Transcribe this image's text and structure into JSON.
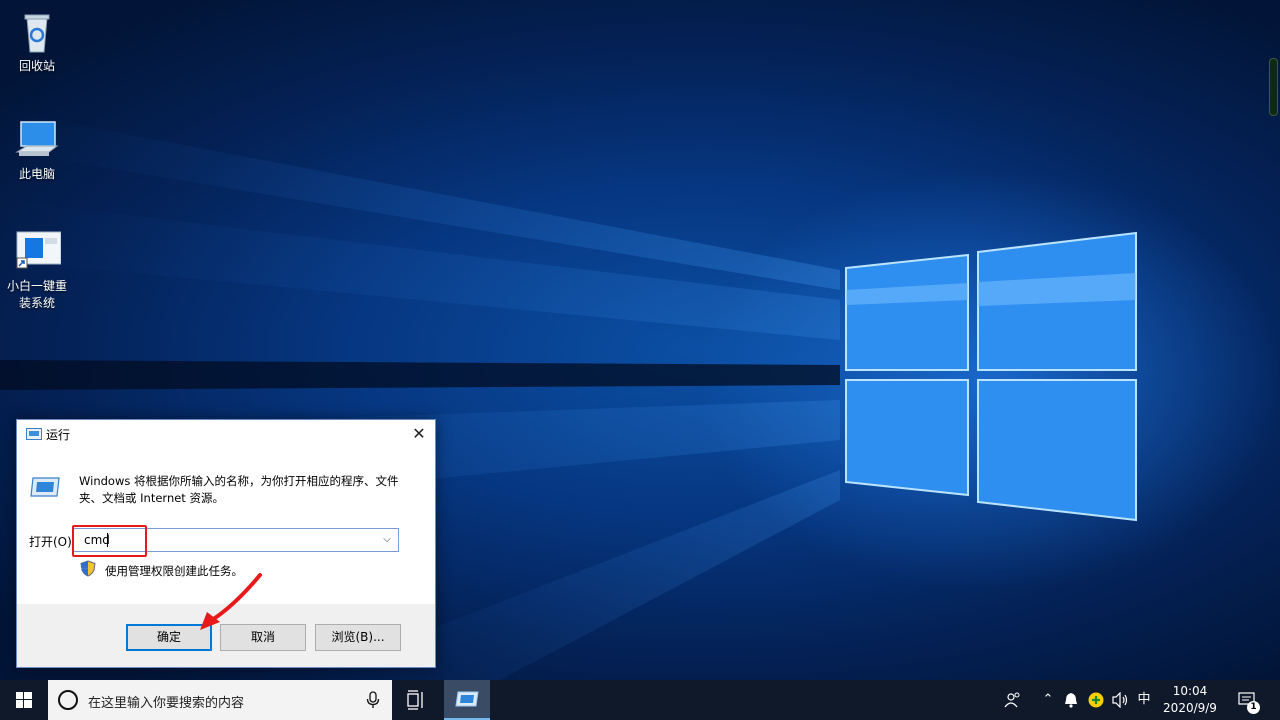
{
  "desktop": {
    "icons": [
      {
        "label": "回收站",
        "icon": "recycle-bin-icon"
      },
      {
        "label": "此电脑",
        "icon": "computer-icon"
      },
      {
        "label": "小白一键重装系统",
        "icon": "app-shortcut-icon"
      }
    ]
  },
  "run_dialog": {
    "title": "运行",
    "description": "Windows 将根据你所输入的名称，为你打开相应的程序、文件夹、文档或 Internet 资源。",
    "open_label": "打开(O):",
    "open_value": "cmd",
    "admin_text": "使用管理权限创建此任务。",
    "ok_label": "确定",
    "cancel_label": "取消",
    "browse_label": "浏览(B)...",
    "colors": {
      "highlight": "#e8191a",
      "accent": "#0078d7"
    }
  },
  "taskbar": {
    "search_placeholder": "在这里输入你要搜索的内容",
    "ime_label": "中",
    "time": "10:04",
    "date": "2020/9/9",
    "notification_count": "1"
  }
}
